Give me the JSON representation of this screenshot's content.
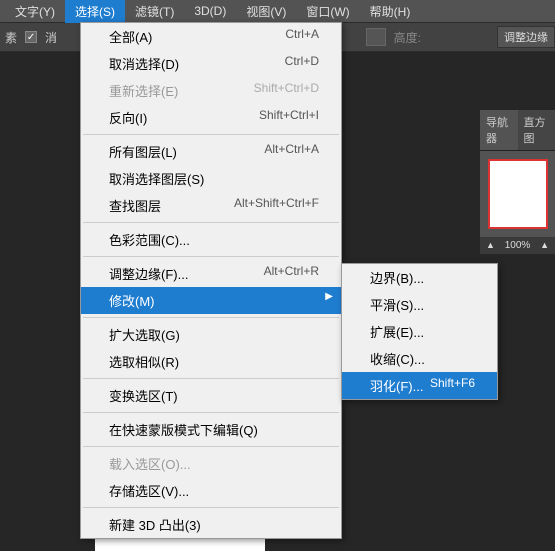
{
  "menubar": {
    "items": [
      "文字(Y)",
      "选择(S)",
      "滤镜(T)",
      "3D(D)",
      "视图(V)",
      "窗口(W)",
      "帮助(H)"
    ],
    "activeIndex": 1
  },
  "toolbar": {
    "px_label": "素",
    "checkbox_label": "消",
    "height_label": "高度:",
    "refine_btn": "调整边缘"
  },
  "dropdown": {
    "groups": [
      [
        {
          "label": "全部(A)",
          "shortcut": "Ctrl+A",
          "disabled": false
        },
        {
          "label": "取消选择(D)",
          "shortcut": "Ctrl+D",
          "disabled": false
        },
        {
          "label": "重新选择(E)",
          "shortcut": "Shift+Ctrl+D",
          "disabled": true
        },
        {
          "label": "反向(I)",
          "shortcut": "Shift+Ctrl+I",
          "disabled": false
        }
      ],
      [
        {
          "label": "所有图层(L)",
          "shortcut": "Alt+Ctrl+A",
          "disabled": false
        },
        {
          "label": "取消选择图层(S)",
          "shortcut": "",
          "disabled": false
        },
        {
          "label": "查找图层",
          "shortcut": "Alt+Shift+Ctrl+F",
          "disabled": false
        }
      ],
      [
        {
          "label": "色彩范围(C)...",
          "shortcut": "",
          "disabled": false
        }
      ],
      [
        {
          "label": "调整边缘(F)...",
          "shortcut": "Alt+Ctrl+R",
          "disabled": false
        },
        {
          "label": "修改(M)",
          "shortcut": "",
          "disabled": false,
          "highlighted": true,
          "hasSubmenu": true
        }
      ],
      [
        {
          "label": "扩大选取(G)",
          "shortcut": "",
          "disabled": false
        },
        {
          "label": "选取相似(R)",
          "shortcut": "",
          "disabled": false
        }
      ],
      [
        {
          "label": "变换选区(T)",
          "shortcut": "",
          "disabled": false
        }
      ],
      [
        {
          "label": "在快速蒙版模式下编辑(Q)",
          "shortcut": "",
          "disabled": false
        }
      ],
      [
        {
          "label": "载入选区(O)...",
          "shortcut": "",
          "disabled": true
        },
        {
          "label": "存储选区(V)...",
          "shortcut": "",
          "disabled": false
        }
      ],
      [
        {
          "label": "新建 3D 凸出(3)",
          "shortcut": "",
          "disabled": false
        }
      ]
    ]
  },
  "submenu": {
    "items": [
      {
        "label": "边界(B)...",
        "shortcut": "",
        "highlighted": false
      },
      {
        "label": "平滑(S)...",
        "shortcut": "",
        "highlighted": false
      },
      {
        "label": "扩展(E)...",
        "shortcut": "",
        "highlighted": false
      },
      {
        "label": "收缩(C)...",
        "shortcut": "",
        "highlighted": false
      },
      {
        "label": "羽化(F)...",
        "shortcut": "Shift+F6",
        "highlighted": true
      }
    ]
  },
  "panels": {
    "tabs": [
      "导航器",
      "直方图"
    ],
    "activeTab": 0,
    "zoom": "100%"
  }
}
